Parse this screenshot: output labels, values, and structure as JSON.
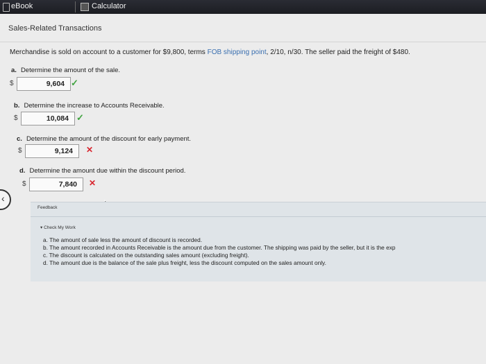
{
  "tabs": {
    "ebook_label": "eBook",
    "calculator_label": "Calculator"
  },
  "page": {
    "title": "Sales-Related Transactions",
    "problem_prefix": "Merchandise is sold on account to a customer for $9,800, terms ",
    "problem_fob": "FOB shipping point",
    "problem_suffix": ", 2/10, n/30. The seller paid the freight of $480."
  },
  "questions": [
    {
      "letter": "a.",
      "text": "Determine the amount of the sale.",
      "currency": "$",
      "value": "9,604",
      "status": "correct"
    },
    {
      "letter": "b.",
      "text": "Determine the increase to Accounts Receivable.",
      "currency": "$",
      "value": "10,084",
      "status": "correct"
    },
    {
      "letter": "c.",
      "text": "Determine the amount of the discount for early payment.",
      "currency": "$",
      "value": "9,124",
      "status": "incorrect"
    },
    {
      "letter": "d.",
      "text": "Determine the amount due within the discount period.",
      "currency": "$",
      "value": "7,840",
      "status": "incorrect"
    }
  ],
  "marks": {
    "correct": "✓",
    "incorrect": "✕"
  },
  "feedback": {
    "label": "Feedback",
    "toggle": "▾ Check My Work",
    "items": [
      "a. The amount of sale less the amount of discount is recorded.",
      "b. The amount recorded in Accounts Receivable is the amount due from the customer. The shipping was paid by the seller, but it is the exp",
      "c. The discount is calculated on the outstanding sales amount (excluding freight).",
      "d. The amount due is the balance of the sale plus freight, less the discount computed on the sales amount only."
    ]
  },
  "colors": {
    "correct": "#3fa33f",
    "incorrect": "#d8252e",
    "link": "#3a6fb0"
  }
}
